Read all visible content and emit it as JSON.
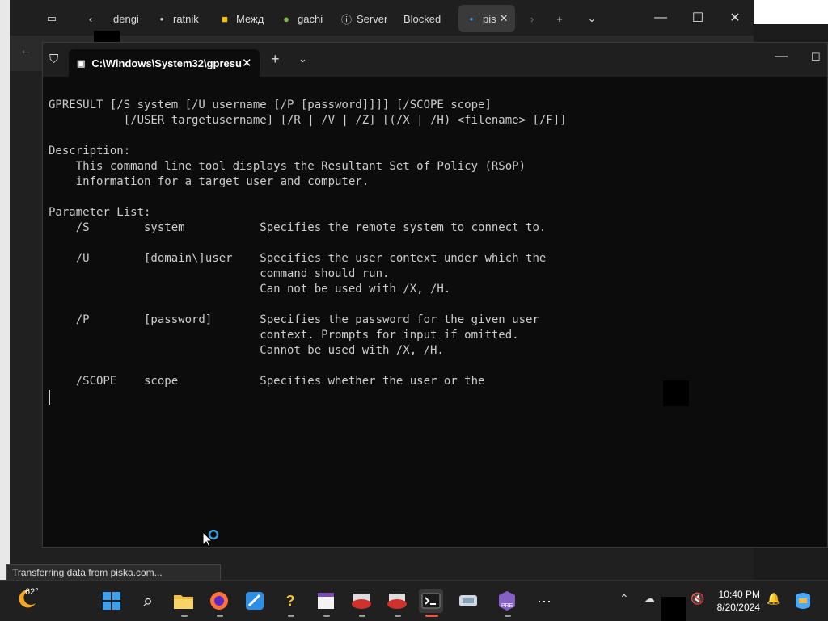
{
  "browser": {
    "tabs": [
      {
        "label": "dengi",
        "icon": "page-icon"
      },
      {
        "label": "ratnik",
        "icon": "dot-icon"
      },
      {
        "label": "Межд",
        "icon": "yellow-app-icon"
      },
      {
        "label": "gachi",
        "icon": "frog-icon"
      },
      {
        "label": "Server",
        "icon": "info-icon"
      },
      {
        "label": "Blocked",
        "icon": ""
      },
      {
        "label": "pis",
        "icon": "loading-dot-icon"
      }
    ],
    "status_text": "Transferring data from piska.com..."
  },
  "terminal": {
    "tab_title": "C:\\Windows\\System32\\gpresu",
    "lines": [
      "GPRESULT [/S system [/U username [/P [password]]]] [/SCOPE scope]",
      "           [/USER targetusername] [/R | /V | /Z] [(/X | /H) <filename> [/F]]",
      "",
      "Description:",
      "    This command line tool displays the Resultant Set of Policy (RSoP)",
      "    information for a target user and computer.",
      "",
      "Parameter List:",
      "    /S        system           Specifies the remote system to connect to.",
      "",
      "    /U        [domain\\]user    Specifies the user context under which the",
      "                               command should run.",
      "                               Can not be used with /X, /H.",
      "",
      "    /P        [password]       Specifies the password for the given user",
      "                               context. Prompts for input if omitted.",
      "                               Cannot be used with /X, /H.",
      "",
      "    /SCOPE    scope            Specifies whether the user or the"
    ]
  },
  "taskbar": {
    "weather_temp": "62°",
    "apps": [
      "start-icon",
      "search-icon",
      "file-explorer-icon",
      "firefox-icon",
      "paint-icon",
      "help-icon",
      "notepad-icon",
      "car-app-icon",
      "car-app-icon-2",
      "terminal-icon",
      "remote-icon",
      "visual-studio-icon",
      "more-icon"
    ],
    "time": "10:40 PM",
    "date": "8/20/2024"
  },
  "colors": {
    "terminal_bg": "#0c0c0c",
    "terminal_text": "#cccccc",
    "taskbar_bg": "#202020",
    "accent": "#0078d4"
  }
}
